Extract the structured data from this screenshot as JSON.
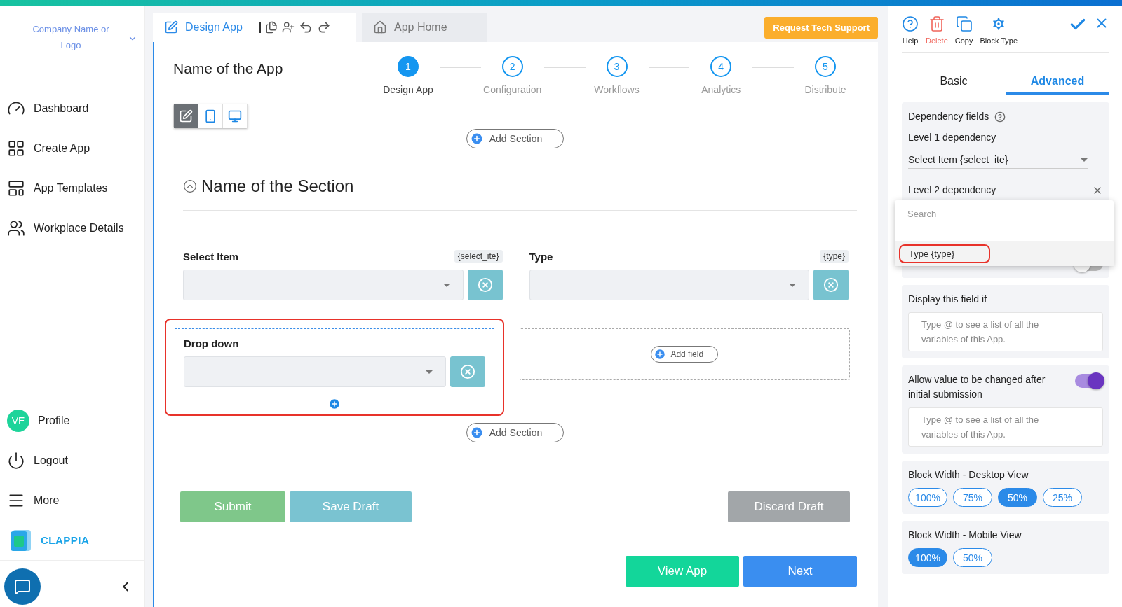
{
  "sidebar": {
    "company": "Company Name or Logo",
    "nav": [
      {
        "label": "Dashboard"
      },
      {
        "label": "Create App"
      },
      {
        "label": "App Templates"
      },
      {
        "label": "Workplace Details"
      }
    ],
    "bottom": [
      {
        "label": "Profile",
        "initials": "VE"
      },
      {
        "label": "Logout"
      },
      {
        "label": "More"
      }
    ],
    "brand": "CLAPPIA"
  },
  "tabs": [
    {
      "label": "Design App",
      "selected": true
    },
    {
      "label": "App Home",
      "selected": false
    }
  ],
  "support_button": "Request Tech Support",
  "app_name": "Name of the App",
  "steps": [
    {
      "number": "1",
      "label": "Design App",
      "selected": true
    },
    {
      "number": "2",
      "label": "Configuration",
      "selected": false
    },
    {
      "number": "3",
      "label": "Workflows",
      "selected": false
    },
    {
      "number": "4",
      "label": "Analytics",
      "selected": false
    },
    {
      "number": "5",
      "label": "Distribute",
      "selected": false
    }
  ],
  "view_modes": [
    {
      "kind": "edit",
      "selected": true
    },
    {
      "kind": "mobile",
      "selected": false
    },
    {
      "kind": "desktop",
      "selected": false
    }
  ],
  "add_section_top": "Add Section",
  "section": {
    "title": "Name of the Section",
    "expanded": true,
    "fields": [
      {
        "label": "Select Item",
        "variable": "{select_ite}",
        "highlighted": false
      },
      {
        "label": "Type",
        "variable": "{type}",
        "highlighted": false
      },
      {
        "label": "Drop down",
        "highlighted": true
      }
    ],
    "add_field": "Add field"
  },
  "add_section_bottom": "Add Section",
  "form_buttons": [
    {
      "label": "Submit",
      "kind": "submit"
    },
    {
      "label": "Save Draft",
      "kind": "draft"
    },
    {
      "label": "Discard Draft",
      "kind": "discard"
    }
  ],
  "nav_buttons": [
    {
      "label": "View App",
      "kind": "view"
    },
    {
      "label": "Next",
      "kind": "next"
    }
  ],
  "panel": {
    "tools": [
      {
        "label": "Help",
        "kind": "help"
      },
      {
        "label": "Delete",
        "kind": "delete"
      },
      {
        "label": "Copy",
        "kind": "copy"
      },
      {
        "label": "Block Type",
        "kind": "settings"
      }
    ],
    "tabs": [
      {
        "label": "Basic",
        "selected": false
      },
      {
        "label": "Advanced",
        "selected": true
      }
    ],
    "dependency": {
      "title": "Dependency fields",
      "level1_label": "Level 1 dependency",
      "level1_value": "Select Item {select_ite}",
      "level2_label": "Level 2 dependency"
    },
    "dropdown": {
      "placeholder": "Search",
      "options": [
        {
          "label": "Type {type}",
          "highlighted": true
        }
      ]
    },
    "multiple_toggle": {
      "on": false
    },
    "display_if": {
      "title": "Display this field if",
      "placeholder": "Type @ to see a list of all the variables of this App."
    },
    "allow_change": {
      "title": "Allow value to be changed after initial submission",
      "on": true,
      "placeholder": "Type @ to see a list of all the variables of this App."
    },
    "width_groups": [
      {
        "title": "Block Width - Desktop View",
        "options": [
          {
            "label": "100%",
            "selected": false
          },
          {
            "label": "75%",
            "selected": false
          },
          {
            "label": "50%",
            "selected": true
          },
          {
            "label": "25%",
            "selected": false
          }
        ]
      },
      {
        "title": "Block Width - Mobile View",
        "options": [
          {
            "label": "100%",
            "selected": true
          },
          {
            "label": "50%",
            "selected": false
          }
        ]
      }
    ]
  }
}
